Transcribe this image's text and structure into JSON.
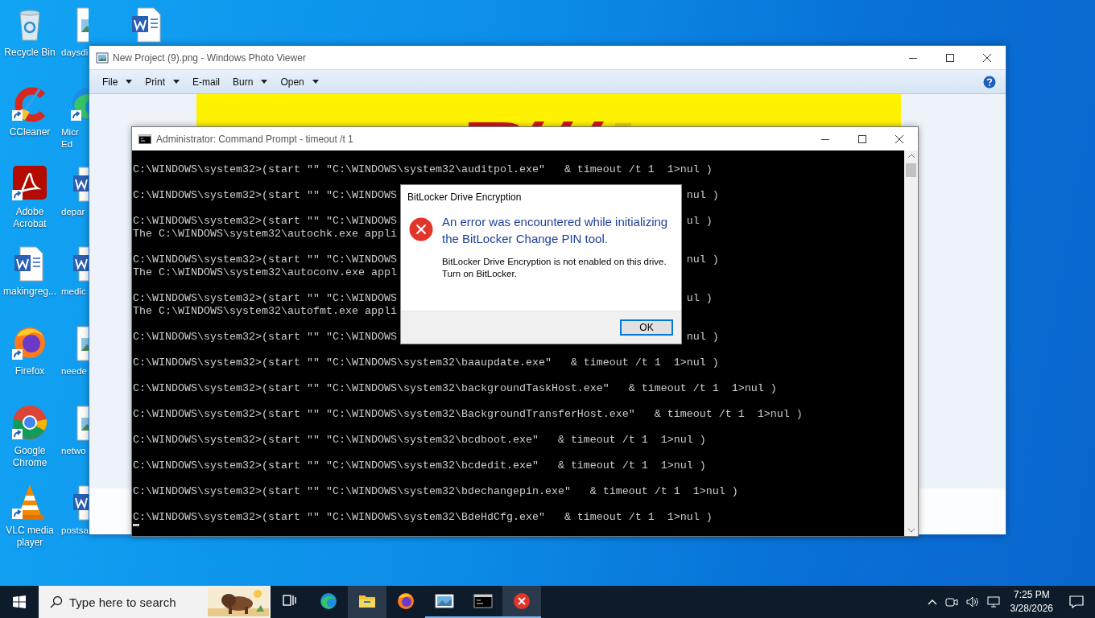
{
  "desktop": {
    "columns": [
      [
        {
          "kind": "recycle-bin",
          "label": "Recycle Bin",
          "shortcut": false
        },
        {
          "kind": "ccleaner",
          "label": "CCleaner",
          "shortcut": true
        },
        {
          "kind": "acrobat",
          "label": "Adobe Acrobat",
          "shortcut": true
        },
        {
          "kind": "word-file",
          "label": "makingreg...",
          "shortcut": false
        },
        {
          "kind": "firefox",
          "label": "Firefox",
          "shortcut": true
        },
        {
          "kind": "chrome",
          "label": "Google Chrome",
          "shortcut": true
        },
        {
          "kind": "vlc",
          "label": "VLC media player",
          "shortcut": true
        }
      ],
      [
        {
          "kind": "image-file",
          "label": "daysdi",
          "shortcut": false
        },
        {
          "kind": "edge",
          "label": "Micr Ed",
          "shortcut": true
        },
        {
          "kind": "word-file",
          "label": "depar",
          "shortcut": false
        },
        {
          "kind": "word-file",
          "label": "medic",
          "shortcut": false
        },
        {
          "kind": "image-file",
          "label": "neede",
          "shortcut": false
        },
        {
          "kind": "image-file",
          "label": "netwo",
          "shortcut": false
        },
        {
          "kind": "word-file",
          "label": "postsa",
          "shortcut": false
        }
      ],
      [
        {
          "kind": "word-file",
          "shortcut": false
        }
      ]
    ]
  },
  "photo_viewer": {
    "title": "New Project (9).png - Windows Photo Viewer",
    "menu": [
      {
        "label": "File",
        "dropdown": true
      },
      {
        "label": "Print",
        "dropdown": true
      },
      {
        "label": "E-mail",
        "dropdown": false
      },
      {
        "label": "Burn",
        "dropdown": true
      },
      {
        "label": "Open",
        "dropdown": true
      }
    ]
  },
  "command_prompt": {
    "title": "Administrator: Command Prompt - timeout  /t 1",
    "blocks": [
      {
        "command": "C:\\WINDOWS\\system32>(start \"\" \"C:\\WINDOWS\\system32\\auditpol.exe\"   & timeout /t 1  1>nul )"
      },
      {
        "command": "C:\\WINDOWS\\system32>(start \"\" \"C:\\WINDOWS",
        "command_tail": "nul )"
      },
      {
        "command": "C:\\WINDOWS\\system32>(start \"\" \"C:\\WINDOWS",
        "command_tail": "ul )",
        "output": "The C:\\WINDOWS\\system32\\autochk.exe appli"
      },
      {
        "command": "C:\\WINDOWS\\system32>(start \"\" \"C:\\WINDOWS",
        "command_tail": "nul )",
        "output": "The C:\\WINDOWS\\system32\\autoconv.exe appl"
      },
      {
        "command": "C:\\WINDOWS\\system32>(start \"\" \"C:\\WINDOWS",
        "command_tail": "ul )",
        "output": "The C:\\WINDOWS\\system32\\autofmt.exe appli"
      },
      {
        "command": "C:\\WINDOWS\\system32>(start \"\" \"C:\\WINDOWS",
        "command_tail": "nul )"
      },
      {
        "command": "C:\\WINDOWS\\system32>(start \"\" \"C:\\WINDOWS\\system32\\baaupdate.exe\"   & timeout /t 1  1>nul )"
      },
      {
        "command": "C:\\WINDOWS\\system32>(start \"\" \"C:\\WINDOWS\\system32\\backgroundTaskHost.exe\"   & timeout /t 1  1>nul )"
      },
      {
        "command": "C:\\WINDOWS\\system32>(start \"\" \"C:\\WINDOWS\\system32\\BackgroundTransferHost.exe\"   & timeout /t 1  1>nul )"
      },
      {
        "command": "C:\\WINDOWS\\system32>(start \"\" \"C:\\WINDOWS\\system32\\bcdboot.exe\"   & timeout /t 1  1>nul )"
      },
      {
        "command": "C:\\WINDOWS\\system32>(start \"\" \"C:\\WINDOWS\\system32\\bcdedit.exe\"   & timeout /t 1  1>nul )"
      },
      {
        "command": "C:\\WINDOWS\\system32>(start \"\" \"C:\\WINDOWS\\system32\\bdechangepin.exe\"   & timeout /t 1  1>nul )"
      },
      {
        "command": "C:\\WINDOWS\\system32>(start \"\" \"C:\\WINDOWS\\system32\\BdeHdCfg.exe\"   & timeout /t 1  1>nul )"
      }
    ]
  },
  "dialog": {
    "title": "BitLocker Drive Encryption",
    "heading": "An error was encountered while initializing the BitLocker Change PIN tool.",
    "message": "BitLocker Drive Encryption is not enabled on this drive.",
    "hint": "Turn on BitLocker.",
    "button": "OK"
  },
  "taskbar": {
    "search": {
      "placeholder": "Type here to search"
    },
    "apps": [
      {
        "kind": "task-view",
        "running": false,
        "highlighted": false
      },
      {
        "kind": "edge",
        "running": false,
        "highlighted": false
      },
      {
        "kind": "file-explorer",
        "running": false,
        "highlighted": true
      },
      {
        "kind": "firefox",
        "running": false,
        "highlighted": false
      },
      {
        "kind": "photo-viewer",
        "running": true,
        "highlighted": false
      },
      {
        "kind": "command-prompt",
        "running": true,
        "highlighted": false
      },
      {
        "kind": "error",
        "running": true,
        "highlighted": true
      }
    ],
    "time": "7:25 PM",
    "date": "3/28/2026"
  }
}
